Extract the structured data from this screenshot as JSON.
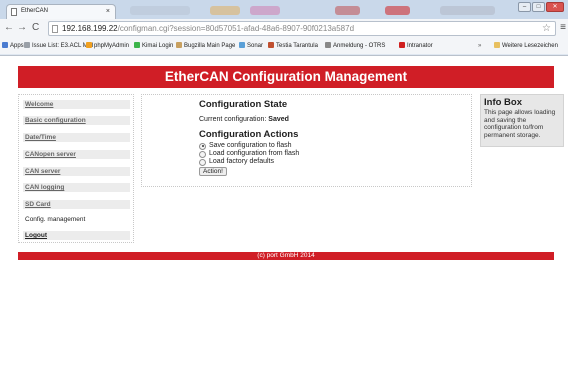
{
  "browser": {
    "tab_title": "EtherCAN",
    "tab_close": "×",
    "url_host": "192.168.199.22",
    "url_path": "/configman.cgi?session=80d57051-afad-48a6-8907-90f0213a587d",
    "bookmarks": [
      {
        "label": "Apps",
        "icon_color": "#4a7bd0"
      },
      {
        "label": "Issue List: E3.ACL MSI",
        "icon_color": "#9aa0a8"
      },
      {
        "label": "phpMyAdmin",
        "icon_color": "#f0a020"
      },
      {
        "label": "Kimai Login",
        "icon_color": "#3cb44b"
      },
      {
        "label": "Bugzilla Main Page",
        "icon_color": "#c8a060"
      },
      {
        "label": "Sonar",
        "icon_color": "#5aa0d8"
      },
      {
        "label": "Testia Tarantula",
        "icon_color": "#c05030"
      },
      {
        "label": "Anmeldung - OTRS",
        "icon_color": "#888888"
      },
      {
        "label": "Intranator",
        "icon_color": "#d02020"
      },
      {
        "label": "Weitere Lesezeichen",
        "icon_color": "#e8c060"
      }
    ],
    "overflow": "»"
  },
  "header": {
    "title": "EtherCAN Configuration Management"
  },
  "nav": {
    "items": [
      {
        "label": "Welcome",
        "kind": "link"
      },
      {
        "label": "Basic configuration",
        "kind": "link"
      },
      {
        "label": "Date/Time",
        "kind": "link"
      },
      {
        "label": "CANopen server",
        "kind": "link"
      },
      {
        "label": "CAN server",
        "kind": "link"
      },
      {
        "label": "CAN logging",
        "kind": "link"
      },
      {
        "label": "SD Card",
        "kind": "link"
      },
      {
        "label": "Config. management",
        "kind": "current"
      },
      {
        "label": "Logout",
        "kind": "logout"
      }
    ]
  },
  "main": {
    "state_heading": "Configuration State",
    "current_label": "Current configuration:",
    "current_value": "Saved",
    "actions_heading": "Configuration Actions",
    "options": [
      {
        "label": "Save configuration to flash",
        "checked": true
      },
      {
        "label": "Load configuration from flash",
        "checked": false
      },
      {
        "label": "Load factory defaults",
        "checked": false
      }
    ],
    "action_button": "Action!"
  },
  "infobox": {
    "title": "Info Box",
    "text": "This page allows loading and saving the configuration to/from permanent storage."
  },
  "footer": {
    "text": "(c) port GmbH 2014"
  },
  "colors": {
    "accent": "#d01e26",
    "nav_bg": "#ececec",
    "info_bg": "#e7e7e7"
  }
}
